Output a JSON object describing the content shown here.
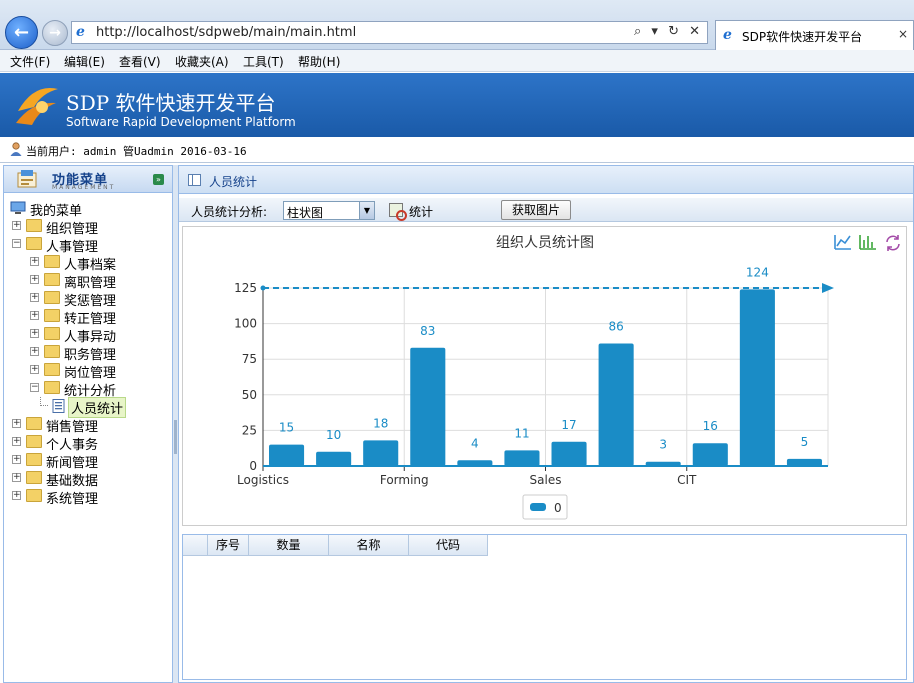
{
  "browser": {
    "url": "http://localhost/sdpweb/main/main.html",
    "address_controls": "⌕ ▾ ↻ ✕",
    "tab_title": "SDP软件快速开发平台",
    "tab_close": "×",
    "back_glyph": "←",
    "forward_glyph": "→",
    "ie_glyph": "e",
    "menu": [
      "文件(F)",
      "编辑(E)",
      "查看(V)",
      "收藏夹(A)",
      "工具(T)",
      "帮助(H)"
    ]
  },
  "app": {
    "title": "SDP 软件快速开发平台",
    "subtitle": "Software Rapid Development Platform",
    "current_user": "当前用户: admin 管Uadmin 2016-03-16"
  },
  "sidebar": {
    "title": "功能菜单",
    "subtitle": "MANAGEMENT",
    "collapse_glyph": "»",
    "tree": [
      {
        "label": "我的菜单",
        "level": 0,
        "type": "root"
      },
      {
        "label": "组织管理",
        "level": 1,
        "type": "folder",
        "toggle": "+"
      },
      {
        "label": "人事管理",
        "level": 1,
        "type": "folder",
        "toggle": "−"
      },
      {
        "label": "人事档案",
        "level": 2,
        "type": "folder",
        "toggle": "+"
      },
      {
        "label": "离职管理",
        "level": 2,
        "type": "folder",
        "toggle": "+"
      },
      {
        "label": "奖惩管理",
        "level": 2,
        "type": "folder",
        "toggle": "+"
      },
      {
        "label": "转正管理",
        "level": 2,
        "type": "folder",
        "toggle": "+"
      },
      {
        "label": "人事异动",
        "level": 2,
        "type": "folder",
        "toggle": "+"
      },
      {
        "label": "职务管理",
        "level": 2,
        "type": "folder",
        "toggle": "+"
      },
      {
        "label": "岗位管理",
        "level": 2,
        "type": "folder",
        "toggle": "+"
      },
      {
        "label": "统计分析",
        "level": 2,
        "type": "folder",
        "toggle": "−"
      },
      {
        "label": "人员统计",
        "level": 3,
        "type": "page",
        "selected": true
      },
      {
        "label": "销售管理",
        "level": 1,
        "type": "folder",
        "toggle": "+"
      },
      {
        "label": "个人事务",
        "level": 1,
        "type": "folder",
        "toggle": "+"
      },
      {
        "label": "新闻管理",
        "level": 1,
        "type": "folder",
        "toggle": "+"
      },
      {
        "label": "基础数据",
        "level": 1,
        "type": "folder",
        "toggle": "+"
      },
      {
        "label": "系统管理",
        "level": 1,
        "type": "folder",
        "toggle": "+"
      }
    ]
  },
  "main": {
    "tab_label": "人员统计",
    "toolbar": {
      "analysis_label": "人员统计分析:",
      "chart_type_value": "柱状图",
      "select_arrow": "▼",
      "stats_label": "统计",
      "get_image_label": "获取图片"
    },
    "grid": {
      "columns": [
        "序号",
        "数量",
        "名称",
        "代码"
      ]
    }
  },
  "colors": {
    "bar": "#1a8cc6",
    "header_blue": "#1a5aa8",
    "toolbox_line": "#3a8fd6",
    "toolbox_bar": "#3aa63a",
    "toolbox_restore": "#a44ca8"
  },
  "chart_data": {
    "type": "bar",
    "title": "组织人员统计图",
    "values": [
      15,
      10,
      18,
      83,
      4,
      11,
      17,
      86,
      3,
      16,
      124,
      5
    ],
    "x_tick_labels": [
      {
        "index": 0,
        "label": "Logistics"
      },
      {
        "index": 3,
        "label": "Forming"
      },
      {
        "index": 6,
        "label": "Sales"
      },
      {
        "index": 9,
        "label": "CIT"
      }
    ],
    "y_ticks": [
      0,
      25,
      50,
      75,
      100,
      125
    ],
    "ylim": [
      0,
      125
    ],
    "markline_value": 125,
    "legend": {
      "name": "0",
      "placement": "bottom-center"
    },
    "grid": true,
    "toolbox": [
      "line-chart-icon",
      "bar-chart-icon",
      "restore-icon"
    ]
  }
}
